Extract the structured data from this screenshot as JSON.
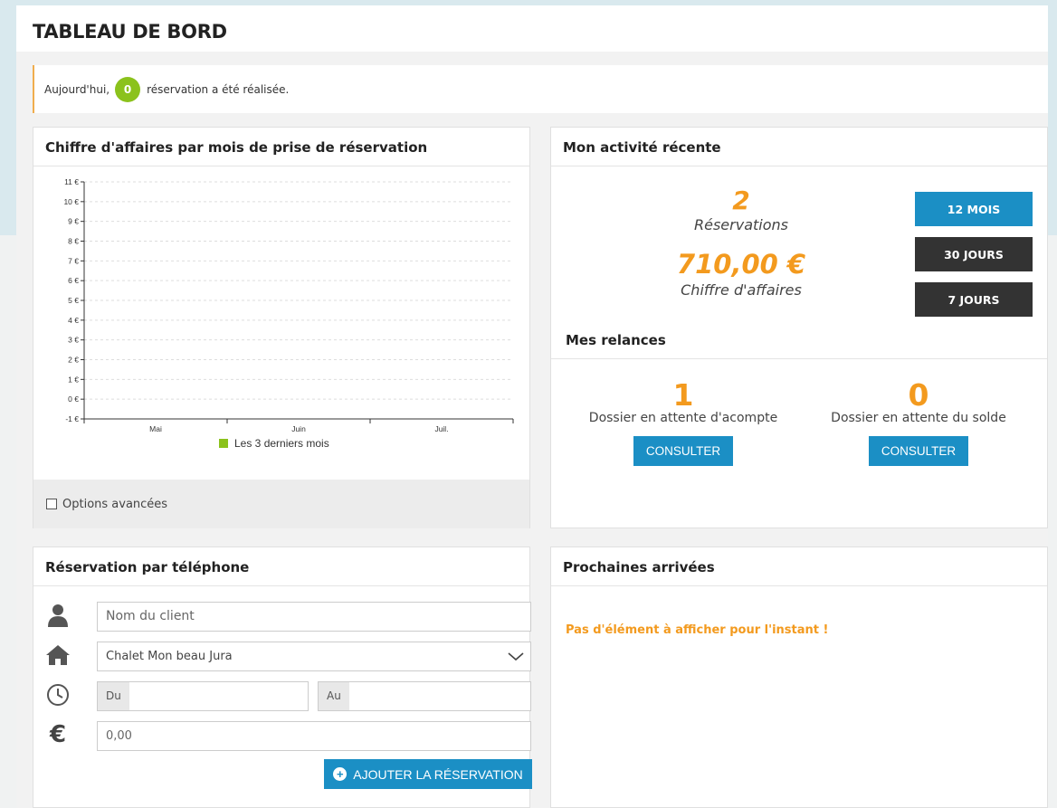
{
  "page": {
    "title": "TABLEAU DE BORD"
  },
  "alert": {
    "prefix": "Aujourd'hui,",
    "count": "0",
    "suffix": "réservation a été réalisée."
  },
  "revenue_panel": {
    "title": "Chiffre d'affaires par mois de prise de réservation",
    "advanced_options_label": "Options avancées"
  },
  "chart_data": {
    "type": "bar",
    "categories": [
      "Mai",
      "Juin",
      "Juil."
    ],
    "series": [
      {
        "name": "Les 3 derniers mois",
        "values": [
          0,
          0,
          0
        ],
        "color": "#8bc21c"
      }
    ],
    "yticks": [
      "11 €",
      "10 €",
      "9 €",
      "8 €",
      "7 €",
      "6 €",
      "5 €",
      "4 €",
      "3 €",
      "2 €",
      "1 €",
      "0 €",
      "-1 €"
    ],
    "ylim": [
      -1,
      11
    ],
    "grid": true,
    "legend": "bottom"
  },
  "activity_panel": {
    "title": "Mon activité récente",
    "reservations_value": "2",
    "reservations_label": "Réservations",
    "revenue_value": "710,00 €",
    "revenue_label": "Chiffre d'affaires",
    "range_buttons": [
      {
        "label": "12 MOIS",
        "active": true,
        "color": "#1b8fc5"
      },
      {
        "label": "30 JOURS",
        "active": false,
        "color": "#333333"
      },
      {
        "label": "7 JOURS",
        "active": false,
        "color": "#333333"
      }
    ]
  },
  "reminders": {
    "title": "Mes relances",
    "items": [
      {
        "value": "1",
        "label": "Dossier en attente d'acompte",
        "button": "CONSULTER"
      },
      {
        "value": "0",
        "label": "Dossier en attente du solde",
        "button": "CONSULTER"
      }
    ]
  },
  "phone_booking": {
    "title": "Réservation par téléphone",
    "client_placeholder": "Nom du client",
    "property_value": "Chalet Mon beau Jura",
    "from_label": "Du",
    "to_label": "Au",
    "amount_value": "0,00",
    "submit_label": "AJOUTER LA RÉSERVATION",
    "icons": [
      "user-icon",
      "home-icon",
      "clock-icon",
      "euro-icon"
    ]
  },
  "arrivals": {
    "title": "Prochaines arrivées",
    "empty_message": "Pas d'élément à afficher pour l'instant !"
  },
  "colors": {
    "accent": "#1b8fc5",
    "orange": "#f39a1e",
    "green": "#8bc21c",
    "dark": "#333333"
  }
}
